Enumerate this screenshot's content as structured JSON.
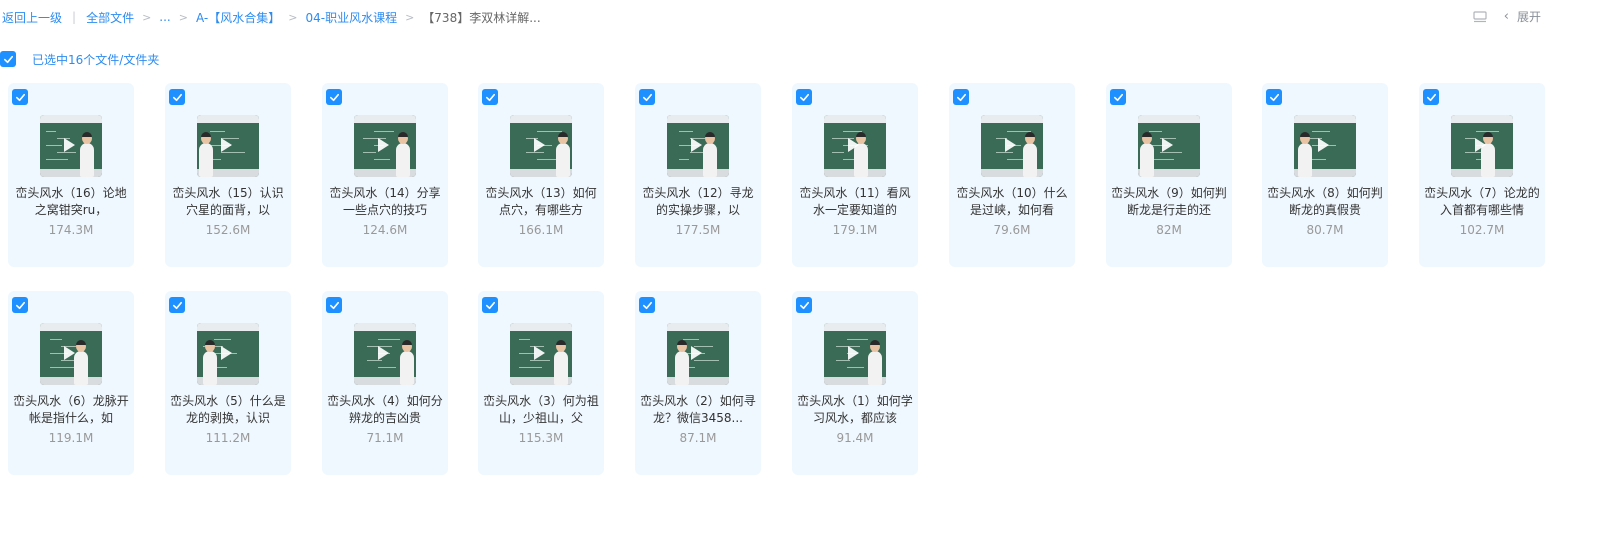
{
  "breadcrumb": {
    "back_label": "返回上一级",
    "all_files_label": "全部文件",
    "ellipsis_label": "...",
    "crumb1_label": "A-【风水合集】",
    "crumb2_label": "04-职业风水课程",
    "current_label": "【738】李双林详解..."
  },
  "toolbar": {
    "expand_label": "展开"
  },
  "selection": {
    "summary_text": "已选中16个文件/文件夹"
  },
  "colors": {
    "accent": "#2d8cf0",
    "card_bg": "#f0f8ff",
    "checkbox": "#1e90ff"
  },
  "files": [
    {
      "name": "峦头风水（16）论地之窝钳突ru，",
      "size": "174.3M",
      "selected": true
    },
    {
      "name": "峦头风水（15）认识穴星的面背，以",
      "size": "152.6M",
      "selected": true
    },
    {
      "name": "峦头风水（14）分享一些点穴的技巧",
      "size": "124.6M",
      "selected": true
    },
    {
      "name": "峦头风水（13）如何点穴，有哪些方",
      "size": "166.1M",
      "selected": true
    },
    {
      "name": "峦头风水（12）寻龙的实操步骤，以",
      "size": "177.5M",
      "selected": true
    },
    {
      "name": "峦头风水（11）看风水一定要知道的",
      "size": "179.1M",
      "selected": true
    },
    {
      "name": "峦头风水（10）什么是过峡，如何看",
      "size": "79.6M",
      "selected": true
    },
    {
      "name": "峦头风水（9）如何判断龙是行走的还",
      "size": "82M",
      "selected": true
    },
    {
      "name": "峦头风水（8）如何判断龙的真假贵",
      "size": "80.7M",
      "selected": true
    },
    {
      "name": "峦头风水（7）论龙的入首都有哪些情",
      "size": "102.7M",
      "selected": true
    },
    {
      "name": "峦头风水（6）龙脉开帐是指什么，如",
      "size": "119.1M",
      "selected": true
    },
    {
      "name": "峦头风水（5）什么是龙的剥换，认识",
      "size": "111.2M",
      "selected": true
    },
    {
      "name": "峦头风水（4）如何分辨龙的吉凶贵",
      "size": "71.1M",
      "selected": true
    },
    {
      "name": "峦头风水（3）何为祖山，少祖山，父",
      "size": "115.3M",
      "selected": true
    },
    {
      "name": "峦头风水（2）如何寻龙？微信3458...",
      "size": "87.1M",
      "selected": true
    },
    {
      "name": "峦头风水（1）如何学习风水，都应该",
      "size": "91.4M",
      "selected": true
    }
  ]
}
